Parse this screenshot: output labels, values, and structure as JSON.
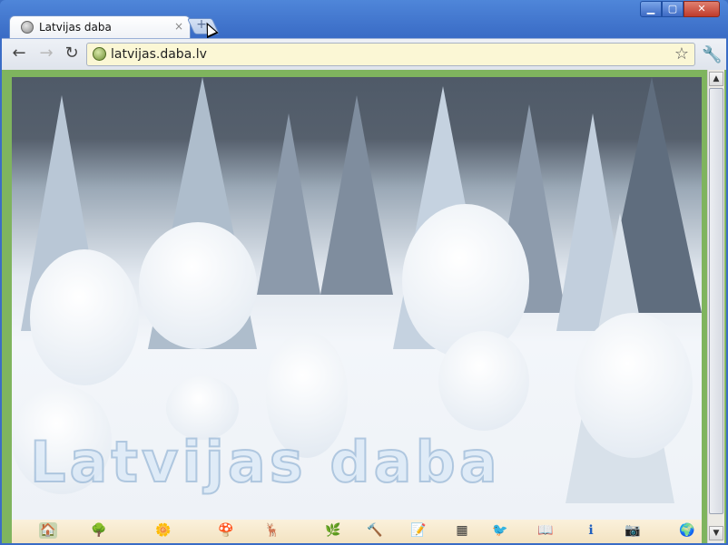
{
  "browser": {
    "tab_title": "Latvijas daba",
    "tab_close": "×",
    "new_tab": "+",
    "window_controls": {
      "minimize": "▁",
      "maximize": "▢",
      "close": "✕"
    }
  },
  "toolbar": {
    "back": "←",
    "forward": "→",
    "reload": "↻",
    "url": "latvijas.daba.lv",
    "star": "☆",
    "wrench": "🔧"
  },
  "page": {
    "watermark": "Latvijas daba"
  },
  "nav_icons": [
    {
      "name": "home-icon",
      "glyph": "🏠",
      "color": "#8aa070"
    },
    {
      "name": "landscape-icon",
      "glyph": "🌳",
      "color": "#6b8f3a"
    },
    {
      "name": "flowers-icon",
      "glyph": "🌼",
      "color": "#e0a020"
    },
    {
      "name": "mushroom-icon",
      "glyph": "🍄",
      "color": "#a0602a"
    },
    {
      "name": "animals-icon",
      "glyph": "🦌",
      "color": "#b06a28"
    },
    {
      "name": "plant-icon",
      "glyph": "🌿",
      "color": "#3fae3f"
    },
    {
      "name": "tools-icon",
      "glyph": "🔨",
      "color": "#2a60b0"
    },
    {
      "name": "text-icon",
      "glyph": "📝",
      "color": "#444444"
    },
    {
      "name": "table-icon",
      "glyph": "▦",
      "color": "#333333"
    },
    {
      "name": "birds-icon",
      "glyph": "🐦",
      "color": "#555555"
    },
    {
      "name": "book-icon",
      "glyph": "📖",
      "color": "#555555"
    },
    {
      "name": "info-icon",
      "glyph": "ℹ",
      "color": "#1f5fbf"
    },
    {
      "name": "camera-icon",
      "glyph": "📷",
      "color": "#555555"
    },
    {
      "name": "globe-icon",
      "glyph": "🌍",
      "color": "#2a7a2a"
    }
  ],
  "scrollbar": {
    "up": "▲",
    "down": "▼"
  }
}
